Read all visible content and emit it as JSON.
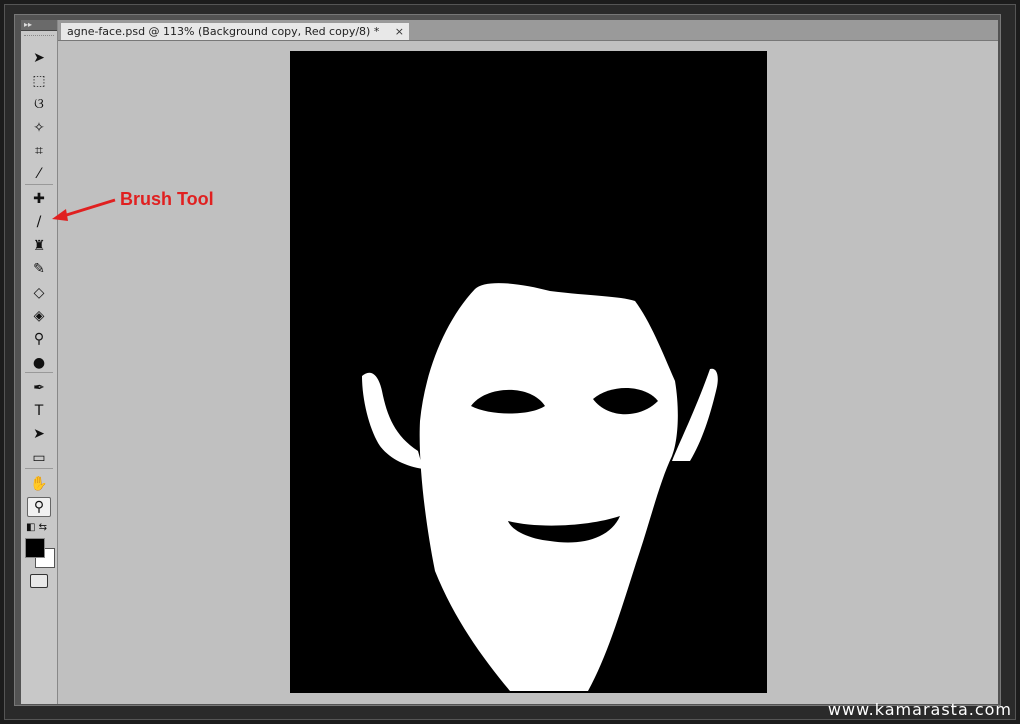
{
  "document_tab": {
    "title": "agne-face.psd @ 113% (Background copy, Red copy/8) *",
    "close": "×"
  },
  "toolbar": {
    "header": "▸▸",
    "tools": [
      {
        "name": "move-tool",
        "glyph": "➤"
      },
      {
        "name": "marquee-tool",
        "glyph": "⬚"
      },
      {
        "name": "lasso-tool",
        "glyph": "ଓ"
      },
      {
        "name": "magic-wand-tool",
        "glyph": "✧"
      },
      {
        "name": "crop-tool",
        "glyph": "⌗"
      },
      {
        "name": "eyedropper-tool",
        "glyph": "⁄"
      },
      {
        "name": "healing-brush-tool",
        "glyph": "✚"
      },
      {
        "name": "brush-tool",
        "glyph": "/"
      },
      {
        "name": "clone-stamp-tool",
        "glyph": "♜"
      },
      {
        "name": "history-brush-tool",
        "glyph": "✎"
      },
      {
        "name": "eraser-tool",
        "glyph": "◇"
      },
      {
        "name": "paint-bucket-tool",
        "glyph": "◈"
      },
      {
        "name": "dodge-tool",
        "glyph": "⚲"
      },
      {
        "name": "burn-tool",
        "glyph": "●"
      },
      {
        "name": "pen-tool",
        "glyph": "✒"
      },
      {
        "name": "type-tool",
        "glyph": "T"
      },
      {
        "name": "path-selection-tool",
        "glyph": "➤"
      },
      {
        "name": "shape-tool",
        "glyph": "▭"
      },
      {
        "name": "hand-tool",
        "glyph": "✋"
      },
      {
        "name": "zoom-tool",
        "glyph": "⚲"
      }
    ],
    "foreground_color": "#000000",
    "background_color": "#ffffff"
  },
  "annotation": {
    "label": "Brush Tool",
    "color": "#e02020"
  },
  "watermark": "www.kamarasta.com"
}
